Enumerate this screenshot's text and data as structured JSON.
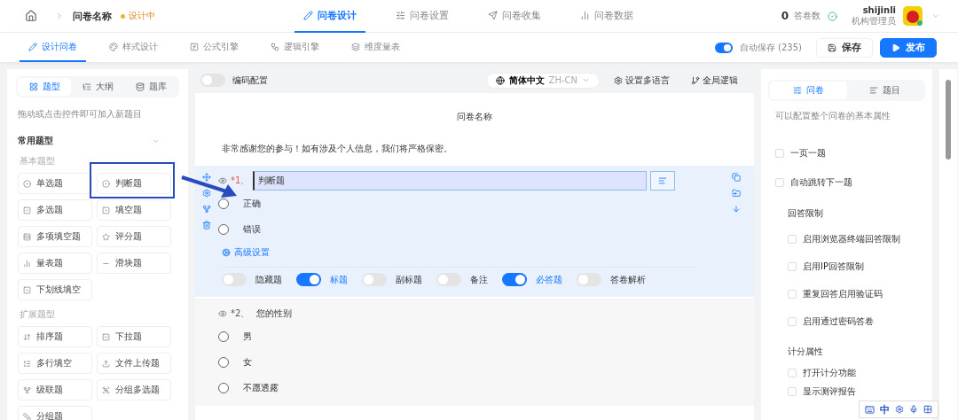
{
  "header": {
    "title": "问卷名称",
    "status": "设计中",
    "nav": [
      {
        "label": "问卷设计",
        "selected": true
      },
      {
        "label": "问卷设置",
        "selected": false
      },
      {
        "label": "问卷收集",
        "selected": false
      },
      {
        "label": "问卷数据",
        "selected": false
      }
    ],
    "count": "0",
    "count_label": "答卷数",
    "user": {
      "name": "shijinli",
      "role": "机构管理员"
    }
  },
  "subnav": {
    "tabs": [
      {
        "label": "设计问卷",
        "selected": true
      },
      {
        "label": "样式设计",
        "selected": false
      },
      {
        "label": "公式引擎",
        "selected": false
      },
      {
        "label": "逻辑引擎",
        "selected": false
      },
      {
        "label": "维度量表",
        "selected": false
      }
    ],
    "autosave": {
      "label": "自动保存 (235)",
      "on": true
    },
    "save": "保存",
    "publish": "发布"
  },
  "left": {
    "tabs": [
      {
        "label": "题型",
        "selected": true
      },
      {
        "label": "大纲",
        "selected": false
      },
      {
        "label": "题库",
        "selected": false
      }
    ],
    "hint": "拖动或点击控件即可加入新题目",
    "section": "常用题型",
    "groups": [
      {
        "title": "基本题型",
        "items": [
          "单选题",
          "判断题",
          "多选题",
          "填空题",
          "多项填空题",
          "评分题",
          "量表题",
          "滑块题",
          "下划线填空"
        ]
      },
      {
        "title": "扩展题型",
        "items": [
          "排序题",
          "下拉题",
          "多行填空",
          "文件上传题",
          "级联题",
          "分组多选题",
          "分组题"
        ]
      }
    ]
  },
  "center": {
    "code_config": {
      "label": "编码配置",
      "on": false
    },
    "language": {
      "name": "简体中文",
      "code": "ZH-CN"
    },
    "multi_lang": "设置多语言",
    "global_logic": "全局逻辑",
    "survey_title": "问卷名称",
    "intro": "非常感谢您的参与！如有涉及个人信息，我们将严格保密。",
    "questions": [
      {
        "number": "*1、",
        "title": "判断题",
        "editing": true,
        "options": [
          "正确",
          "错误"
        ],
        "advanced": "高级设置",
        "toggles": [
          {
            "label": "隐藏题",
            "on": false
          },
          {
            "label": "标题",
            "on": true
          },
          {
            "label": "副标题",
            "on": false
          },
          {
            "label": "备注",
            "on": false
          },
          {
            "label": "必答题",
            "on": true
          },
          {
            "label": "答卷解析",
            "on": false
          }
        ]
      },
      {
        "number": "*2、",
        "title": "您的性别",
        "editing": false,
        "options": [
          "男",
          "女",
          "不愿透露"
        ]
      }
    ]
  },
  "right": {
    "tabs": [
      {
        "label": "问卷",
        "selected": true
      },
      {
        "label": "题目",
        "selected": false
      }
    ],
    "hint": "可以配置整个问卷的基本属性",
    "items": [
      {
        "kind": "checkbox",
        "label": "一页一题",
        "checked": false
      },
      {
        "kind": "checkbox",
        "label": "自动跳转下一题",
        "checked": false
      },
      {
        "kind": "heading",
        "label": "回答限制",
        "children": [
          {
            "label": "启用浏览器终端回答限制",
            "checked": false
          },
          {
            "label": "启用IP回答限制",
            "checked": false
          },
          {
            "label": "重复回答启用验证码",
            "checked": false
          },
          {
            "label": "启用通过密码答卷",
            "checked": false
          }
        ]
      },
      {
        "kind": "heading",
        "label": "计分属性",
        "children": [
          {
            "label": "打开计分功能",
            "checked": false
          },
          {
            "label": "显示测评报告",
            "checked": false
          }
        ]
      }
    ]
  },
  "ime": {
    "label": "中"
  }
}
